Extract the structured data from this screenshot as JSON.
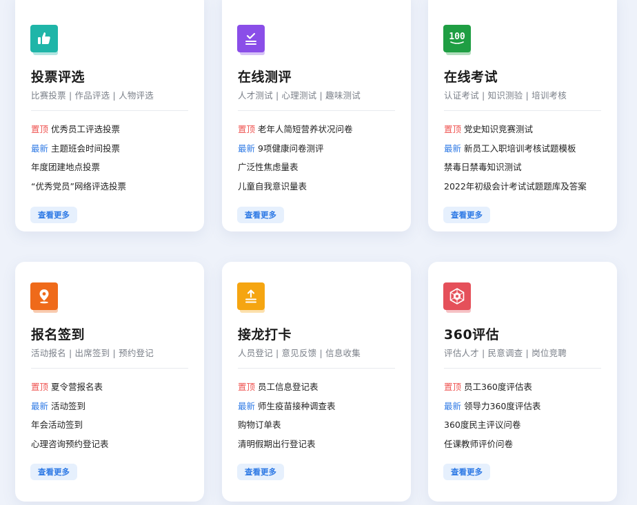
{
  "cards": [
    {
      "icon": "thumbs-up-icon",
      "color": "#1fb5a8",
      "title": "投票评选",
      "subtitle": "比赛投票 |  作品评选 | 人物评选",
      "items": [
        {
          "tag": "置顶",
          "tag_type": "top",
          "text": "优秀员工评选投票"
        },
        {
          "tag": "最新",
          "tag_type": "new",
          "text": "主题班会时间投票"
        },
        {
          "tag": "",
          "tag_type": "",
          "text": "年度团建地点投票"
        },
        {
          "tag": "",
          "tag_type": "",
          "text": "“优秀党员”网络评选投票"
        }
      ],
      "more": "查看更多"
    },
    {
      "icon": "checklist-icon",
      "color": "#8a4ee8",
      "title": "在线测评",
      "subtitle": "人才测试 |  心理测试 | 趣味测试",
      "items": [
        {
          "tag": "置顶",
          "tag_type": "top",
          "text": "老年人简短营养状况问卷"
        },
        {
          "tag": "最新",
          "tag_type": "new",
          "text": "9项健康问卷测评"
        },
        {
          "tag": "",
          "tag_type": "",
          "text": "广泛性焦虑量表"
        },
        {
          "tag": "",
          "tag_type": "",
          "text": "儿童自我意识量表"
        }
      ],
      "more": "查看更多"
    },
    {
      "icon": "score-100-icon",
      "color": "#1f9e43",
      "badge_text": "100",
      "title": "在线考试",
      "subtitle": "认证考试 | 知识测验 | 培训考核",
      "items": [
        {
          "tag": "置顶",
          "tag_type": "top",
          "text": "党史知识竞赛测试"
        },
        {
          "tag": "最新",
          "tag_type": "new",
          "text": "新员工入职培训考核试题模板"
        },
        {
          "tag": "",
          "tag_type": "",
          "text": "禁毒日禁毒知识测试"
        },
        {
          "tag": "",
          "tag_type": "",
          "text": "2022年初级会计考试试题题库及答案"
        }
      ],
      "more": "查看更多"
    },
    {
      "icon": "location-pin-icon",
      "color": "#ef6a1a",
      "title": "报名签到",
      "subtitle": "活动报名 |  出席签到 | 预约登记",
      "items": [
        {
          "tag": "置顶",
          "tag_type": "top",
          "text": "夏令营报名表"
        },
        {
          "tag": "最新",
          "tag_type": "new",
          "text": "活动签到"
        },
        {
          "tag": "",
          "tag_type": "",
          "text": "年会活动签到"
        },
        {
          "tag": "",
          "tag_type": "",
          "text": "心理咨询预约登记表"
        }
      ],
      "more": "查看更多"
    },
    {
      "icon": "upload-icon",
      "color": "#f5a511",
      "title": "接龙打卡",
      "subtitle": "人员登记 | 意见反馈 | 信息收集",
      "items": [
        {
          "tag": "置顶",
          "tag_type": "top",
          "text": "员工信息登记表"
        },
        {
          "tag": "最新",
          "tag_type": "new",
          "text": "师生疫苗接种调查表"
        },
        {
          "tag": "",
          "tag_type": "",
          "text": "购物订单表"
        },
        {
          "tag": "",
          "tag_type": "",
          "text": "清明假期出行登记表"
        }
      ],
      "more": "查看更多"
    },
    {
      "icon": "radar-360-icon",
      "color": "#e5505a",
      "title": "360评估",
      "subtitle": "评估人才 |  民意调查 | 岗位竞聘",
      "items": [
        {
          "tag": "置顶",
          "tag_type": "top",
          "text": "员工360度评估表"
        },
        {
          "tag": "最新",
          "tag_type": "new",
          "text": "领导力360度评估表"
        },
        {
          "tag": "",
          "tag_type": "",
          "text": "360度民主评议问卷"
        },
        {
          "tag": "",
          "tag_type": "",
          "text": "任课教师评价问卷"
        }
      ],
      "more": "查看更多"
    }
  ]
}
